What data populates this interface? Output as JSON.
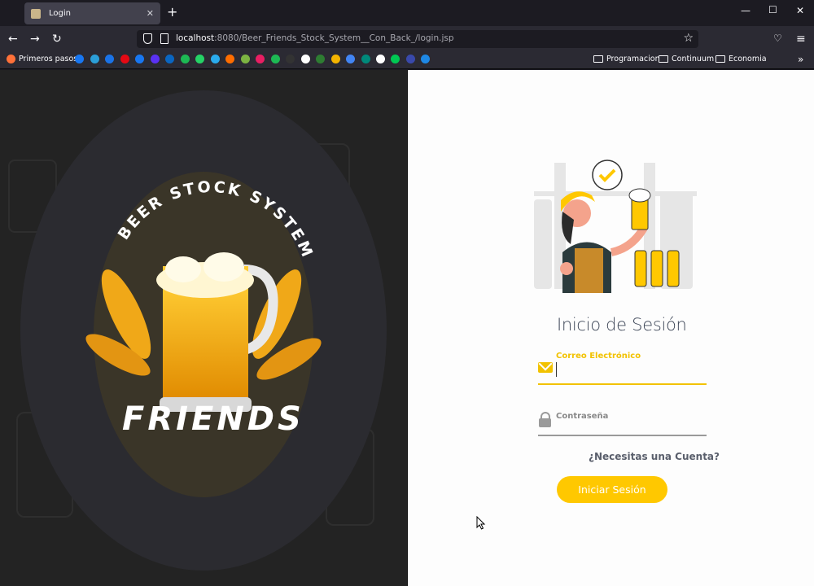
{
  "browser": {
    "tab_title": "Login",
    "tab_close": "✕",
    "new_tab": "+",
    "url_host": "localhost",
    "url_path": ":8080/Beer_Friends_Stock_System__Con_Back_/login.jsp",
    "bookmarks": [
      {
        "label": "Primeros pasos",
        "color": "#ff7139"
      },
      {
        "label": "Programacion",
        "type": "folder"
      },
      {
        "label": "Continuum",
        "type": "folder"
      },
      {
        "label": "Economia",
        "type": "folder"
      }
    ],
    "bookmark_icon_colors": [
      "#1877f2",
      "#2b9fd9",
      "#1a73e8",
      "#e50914",
      "#1877f2",
      "#5a31f4",
      "#0a66c2",
      "#1db954",
      "#25d366",
      "#2aabee",
      "#ff6d00",
      "#7cb342",
      "#e91e63",
      "#1db954",
      "#333333",
      "#ffffff",
      "#2e7d32",
      "#f4b400",
      "#4285f4",
      "#00897b",
      "#ffffff",
      "#00c853",
      "#3949ab",
      "#1e88e5"
    ]
  },
  "left_panel": {
    "logo_arc_text": "BEER STOCK SYSTEM",
    "logo_wordmark": "FRIENDS",
    "dot_colors": [
      "#e53935",
      "#f9a825",
      "#1e88e5",
      "#e53935",
      "#f9a825",
      "#1e88e5"
    ]
  },
  "login": {
    "title": "Inicio de Sesión",
    "email_label": "Correo Electrónico",
    "email_value": "",
    "password_label": "Contraseña",
    "password_value": "",
    "signup_link": "¿Necesitas una Cuenta?",
    "submit_label": "Iniciar Sesión"
  },
  "colors": {
    "accent": "#ffc800",
    "title": "#3d4657",
    "left_bg": "#232323"
  }
}
